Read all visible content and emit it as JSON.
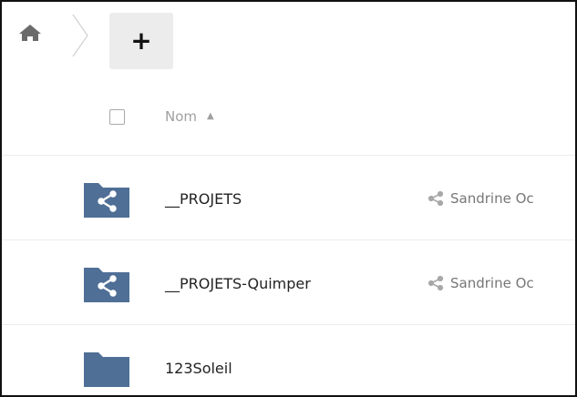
{
  "toolbar": {
    "home_icon": "home-icon",
    "new_label": "+"
  },
  "header": {
    "name_label": "Nom",
    "sort_indicator": "▲"
  },
  "files": [
    {
      "name": "__PROJETS",
      "shared_by": "Sandrine Oc",
      "type": "shared-folder"
    },
    {
      "name": "__PROJETS-Quimper",
      "shared_by": "Sandrine Oc",
      "type": "shared-folder"
    },
    {
      "name": "123Soleil",
      "shared_by": "",
      "type": "folder"
    }
  ],
  "colors": {
    "folder": "#4f6f96",
    "new_button_bg": "#ececec",
    "muted_text": "#a0a0a0"
  }
}
